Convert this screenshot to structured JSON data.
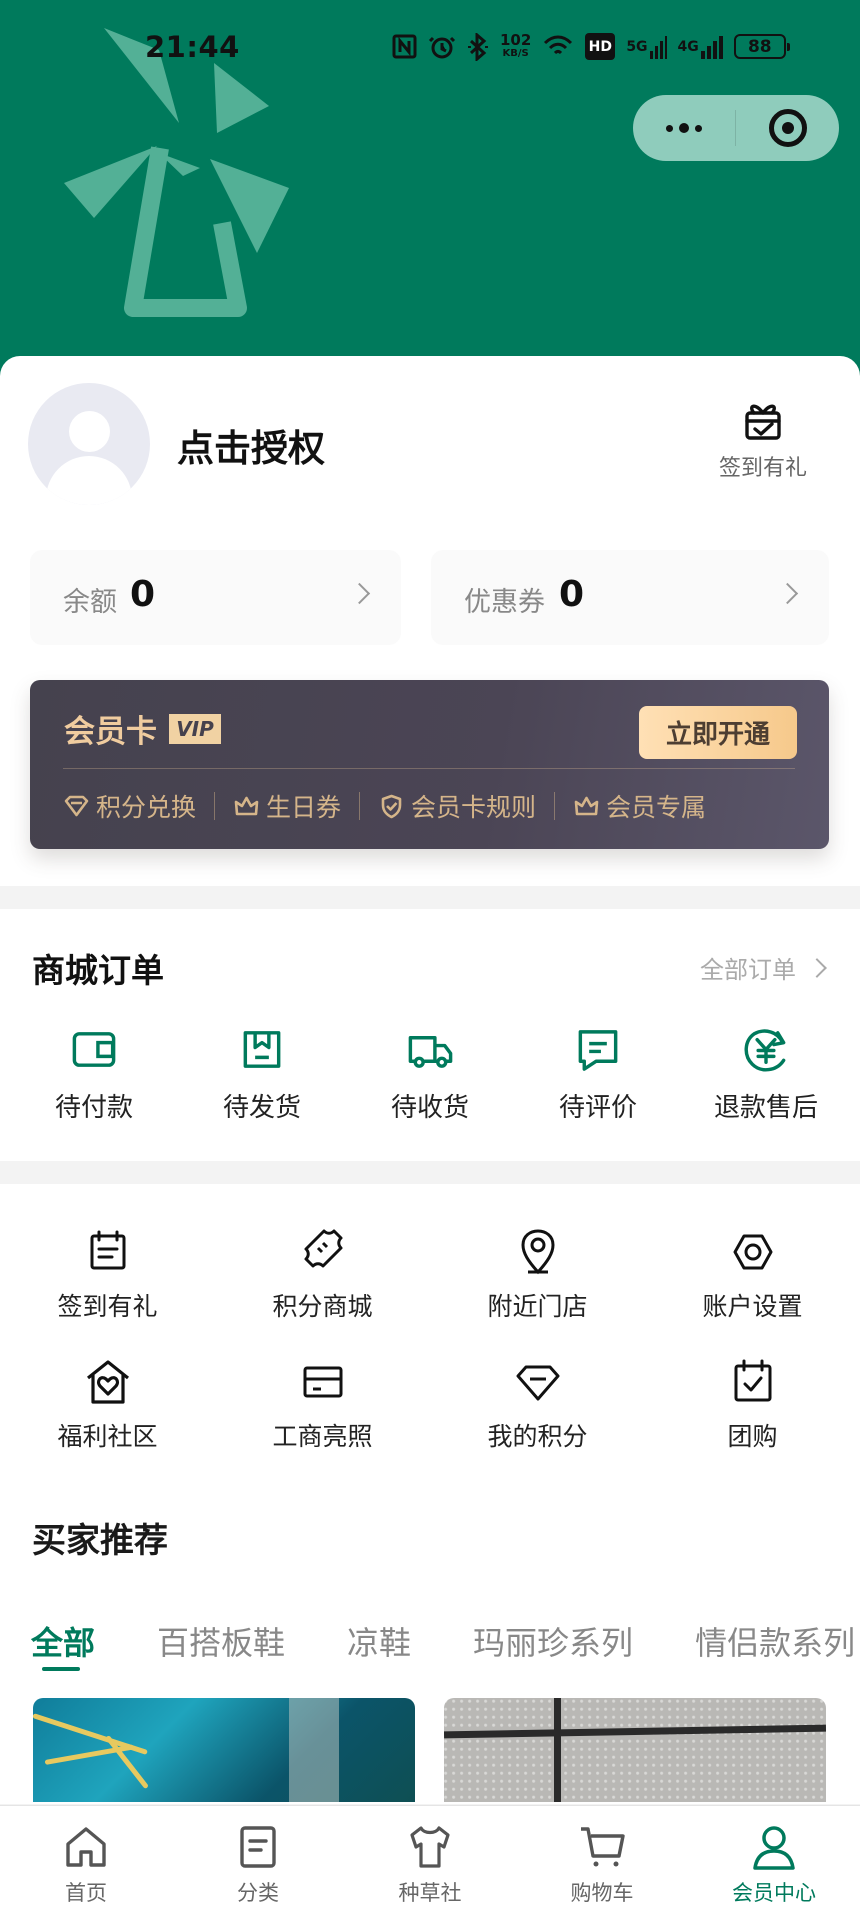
{
  "status_bar": {
    "time": "21:44",
    "network_speed": "102",
    "network_speed_unit": "KB/S",
    "hd_label": "HD",
    "signal_5g": "5G",
    "signal_4g": "4G",
    "battery": "88"
  },
  "header": {
    "background_color": "#007a5c",
    "logo_icon": "windmill-logo-icon",
    "capsule": {
      "menu_icon": "more-dots-icon",
      "close_icon": "target-close-icon"
    }
  },
  "profile": {
    "name": "点击授权",
    "signin_label": "签到有礼",
    "signin_icon": "gift-check-icon"
  },
  "metrics": {
    "balance_label": "余额",
    "balance_value": "0",
    "coupon_label": "优惠券",
    "coupon_value": "0"
  },
  "vip": {
    "title": "会员卡",
    "badge": "VIP",
    "button": "立即开通",
    "features": [
      {
        "label": "积分兑换",
        "icon": "diamond-outline-icon"
      },
      {
        "label": "生日券",
        "icon": "crown-outline-icon"
      },
      {
        "label": "会员卡规则",
        "icon": "shield-check-icon"
      },
      {
        "label": "会员专属",
        "icon": "crown-outline-icon"
      }
    ]
  },
  "orders": {
    "title": "商城订单",
    "all_orders": "全部订单",
    "items": [
      {
        "label": "待付款",
        "icon": "wallet-icon"
      },
      {
        "label": "待发货",
        "icon": "package-icon"
      },
      {
        "label": "待收货",
        "icon": "truck-icon"
      },
      {
        "label": "待评价",
        "icon": "message-icon"
      },
      {
        "label": "退款售后",
        "icon": "refund-yen-icon"
      }
    ]
  },
  "services": [
    {
      "label": "签到有礼",
      "icon": "calendar-note-icon"
    },
    {
      "label": "积分商城",
      "icon": "ticket-icon"
    },
    {
      "label": "附近门店",
      "icon": "location-pin-icon"
    },
    {
      "label": "账户设置",
      "icon": "settings-hex-icon"
    },
    {
      "label": "福利社区",
      "icon": "heart-house-icon"
    },
    {
      "label": "工商亮照",
      "icon": "card-icon"
    },
    {
      "label": "我的积分",
      "icon": "points-diamond-icon"
    },
    {
      "label": "团购",
      "icon": "calendar-check-icon"
    }
  ],
  "recommend": {
    "title": "买家推荐",
    "tabs": [
      "全部",
      "百搭板鞋",
      "凉鞋",
      "玛丽珍系列",
      "情侣款系列"
    ]
  },
  "bottom_nav": [
    {
      "label": "首页",
      "icon": "home-icon"
    },
    {
      "label": "分类",
      "icon": "category-list-icon"
    },
    {
      "label": "种草社",
      "icon": "tshirt-icon"
    },
    {
      "label": "购物车",
      "icon": "cart-icon"
    },
    {
      "label": "会员中心",
      "icon": "user-icon"
    }
  ],
  "colors": {
    "accent": "#007a5c",
    "vip_gold": "#f0cc9f",
    "vip_bg": "#46424f",
    "text_muted": "#888888"
  }
}
